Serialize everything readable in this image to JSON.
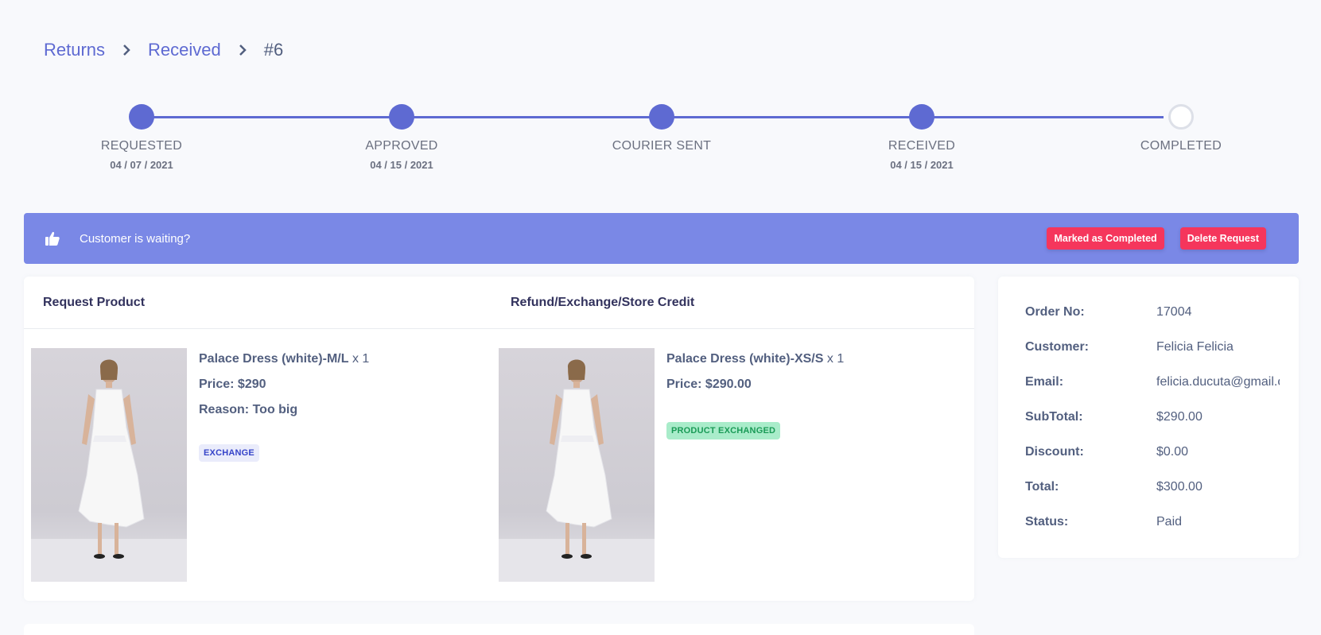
{
  "breadcrumb": {
    "returns": "Returns",
    "received": "Received",
    "current": "#6"
  },
  "stepper": {
    "steps": [
      {
        "label": "REQUESTED",
        "date": "04 / 07 / 2021",
        "done": true
      },
      {
        "label": "APPROVED",
        "date": "04 / 15 / 2021",
        "done": true
      },
      {
        "label": "COURIER SENT",
        "date": "",
        "done": true
      },
      {
        "label": "RECEIVED",
        "date": "04 / 15 / 2021",
        "done": true
      },
      {
        "label": "COMPLETED",
        "date": "",
        "done": false
      }
    ],
    "accent": "#5e6ad2"
  },
  "banner": {
    "message": "Customer is waiting?",
    "complete_label": "Marked as Completed",
    "delete_label": "Delete Request",
    "icon": "thumbs-up-icon",
    "color": "#7a88e6"
  },
  "request_card": {
    "header_left": "Request Product",
    "header_right": "Refund/Exchange/Store Credit",
    "requested": {
      "name": "Palace Dress (white)-M/L",
      "qty": "x 1",
      "price_label": "Price:",
      "price": "$290",
      "reason_label": "Reason:",
      "reason": "Too big",
      "badge": "EXCHANGE"
    },
    "exchange": {
      "name": "Palace Dress (white)-XS/S",
      "qty": "x 1",
      "price_label": "Price:",
      "price": "$290.00",
      "badge": "PRODUCT EXCHANGED"
    }
  },
  "order": {
    "rows": [
      {
        "key": "Order No:",
        "value": "17004"
      },
      {
        "key": "Customer:",
        "value": "Felicia Felicia"
      },
      {
        "key": "Email:",
        "value": "felicia.ducuta@gmail.com"
      },
      {
        "key": "SubTotal:",
        "value": "$290.00"
      },
      {
        "key": "Discount:",
        "value": "$0.00"
      },
      {
        "key": "Total:",
        "value": "$300.00"
      },
      {
        "key": "Status:",
        "value": "Paid"
      }
    ]
  },
  "colors": {
    "danger": "#f5365c",
    "success_bg": "#a9ecca",
    "success_text": "#1a9b57"
  }
}
